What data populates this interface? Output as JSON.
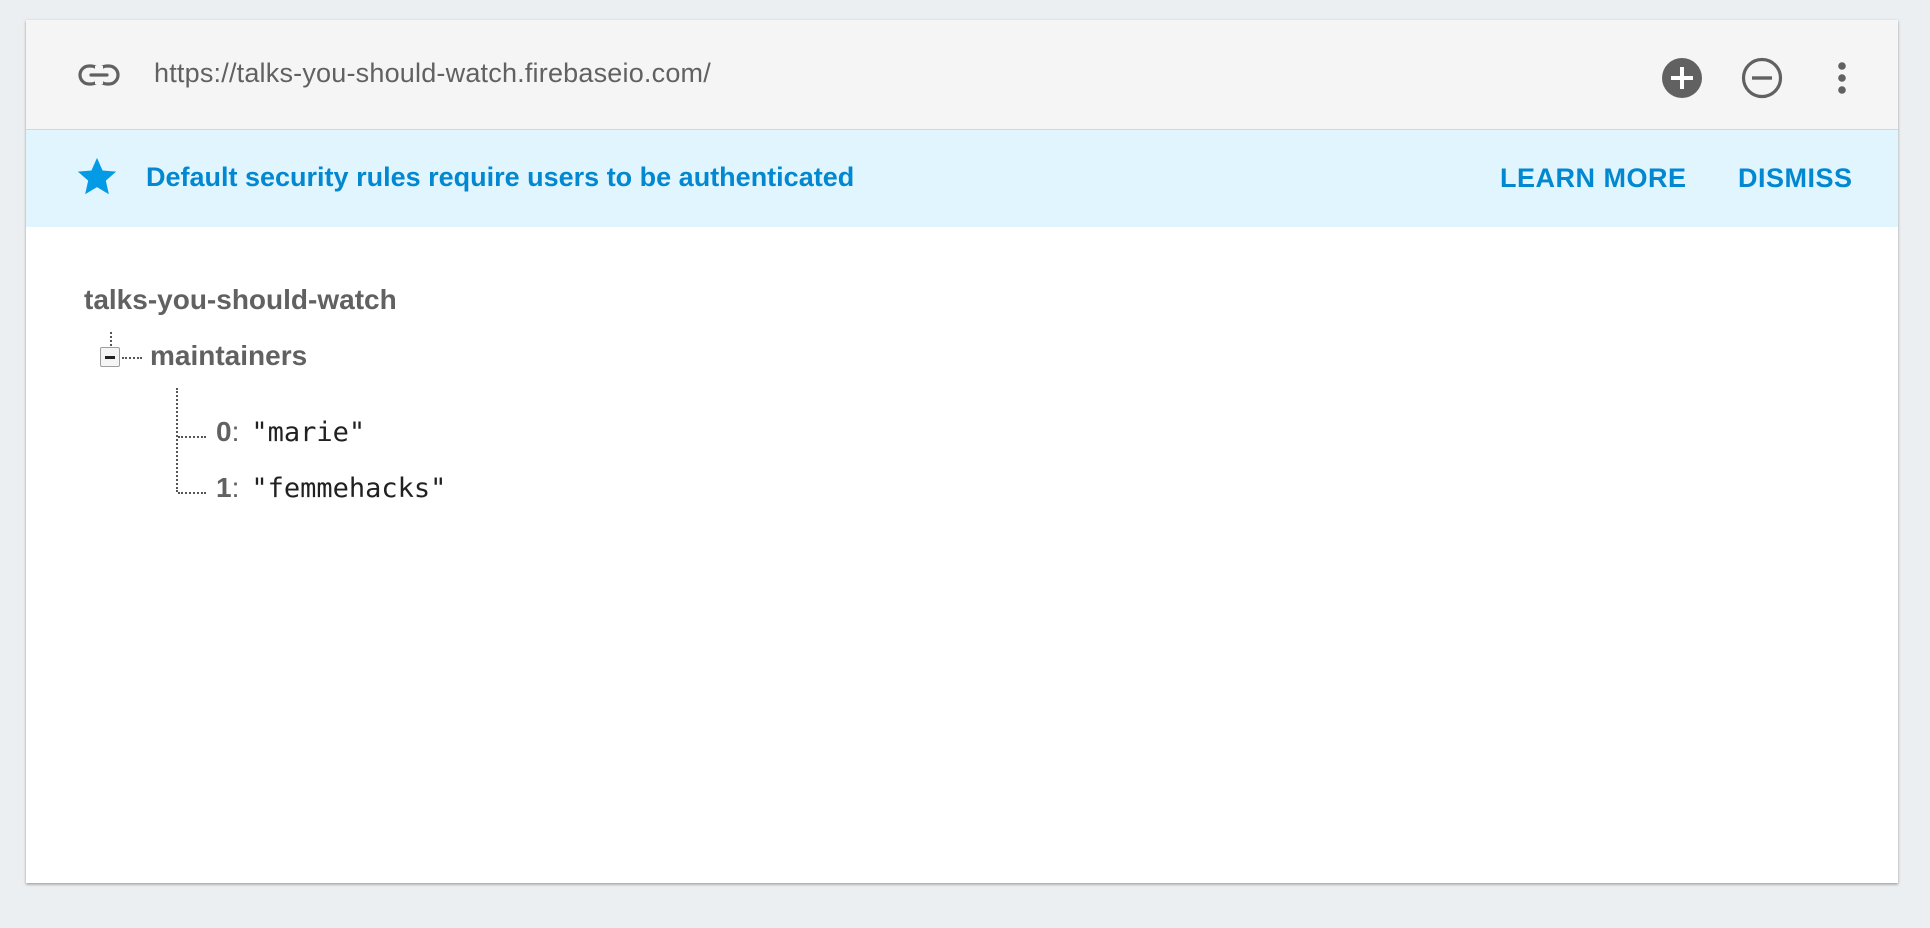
{
  "urlbar": {
    "url": "https://talks-you-should-watch.firebaseio.com/",
    "link_icon": "link-icon",
    "add_icon": "add-circle-icon",
    "remove_icon": "remove-circle-outline-icon",
    "more_icon": "more-vert-icon"
  },
  "banner": {
    "icon": "star-icon",
    "message": "Default security rules require users to be authenticated",
    "learn_more_label": "LEARN MORE",
    "dismiss_label": "DISMISS",
    "background_color": "#e1f5fe",
    "text_color": "#0288d1"
  },
  "tree": {
    "root": "talks-you-should-watch",
    "node": {
      "label": "maintainers",
      "children": [
        {
          "key": "0",
          "value": "\"marie\""
        },
        {
          "key": "1",
          "value": "\"femmehacks\""
        }
      ]
    }
  }
}
